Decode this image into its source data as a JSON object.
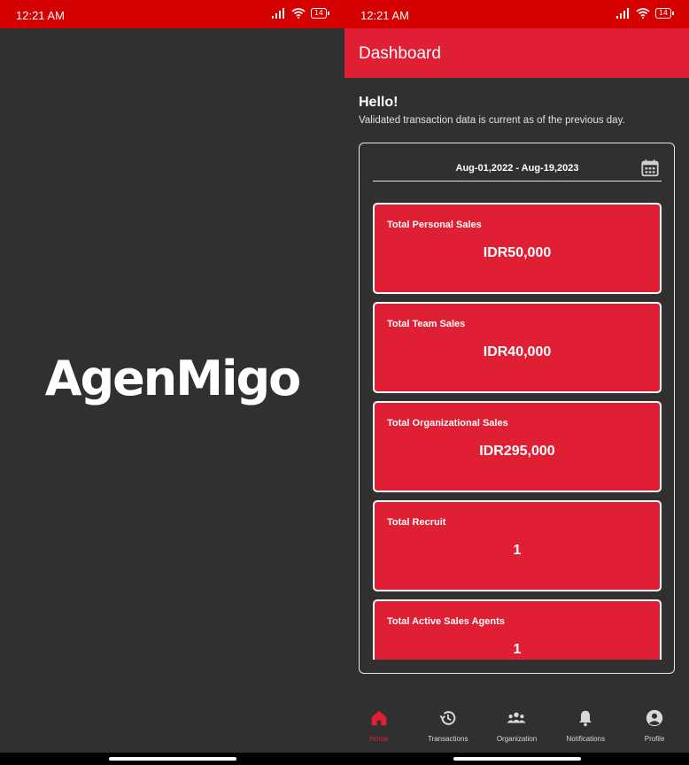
{
  "left_screen": {
    "status_time": "12:21 AM",
    "battery": "14",
    "logo_text": "AgenMigo"
  },
  "right_screen": {
    "status_time": "12:21 AM",
    "battery": "14",
    "app_title": "Dashboard",
    "greeting": "Hello!",
    "subtitle": "Validated transaction data is current as of the previous day.",
    "date_range": "Aug-01,2022 - Aug-19,2023",
    "cards": [
      {
        "label": "Total Personal Sales",
        "value": "IDR50,000"
      },
      {
        "label": "Total Team Sales",
        "value": "IDR40,000"
      },
      {
        "label": "Total Organizational Sales",
        "value": "IDR295,000"
      },
      {
        "label": "Total Recruit",
        "value": "1"
      },
      {
        "label": "Total Active Sales Agents",
        "value": "1"
      }
    ],
    "nav": [
      {
        "label": "Home",
        "icon": "home-icon",
        "active": true
      },
      {
        "label": "Transactions",
        "icon": "history-icon",
        "active": false
      },
      {
        "label": "Organization",
        "icon": "people-icon",
        "active": false
      },
      {
        "label": "Notifications",
        "icon": "bell-icon",
        "active": false
      },
      {
        "label": "Profile",
        "icon": "account-icon",
        "active": false
      }
    ]
  },
  "colors": {
    "status_bar": "#d50000",
    "accent": "#e01f35",
    "background": "#303030",
    "card_border": "#ffffff"
  }
}
